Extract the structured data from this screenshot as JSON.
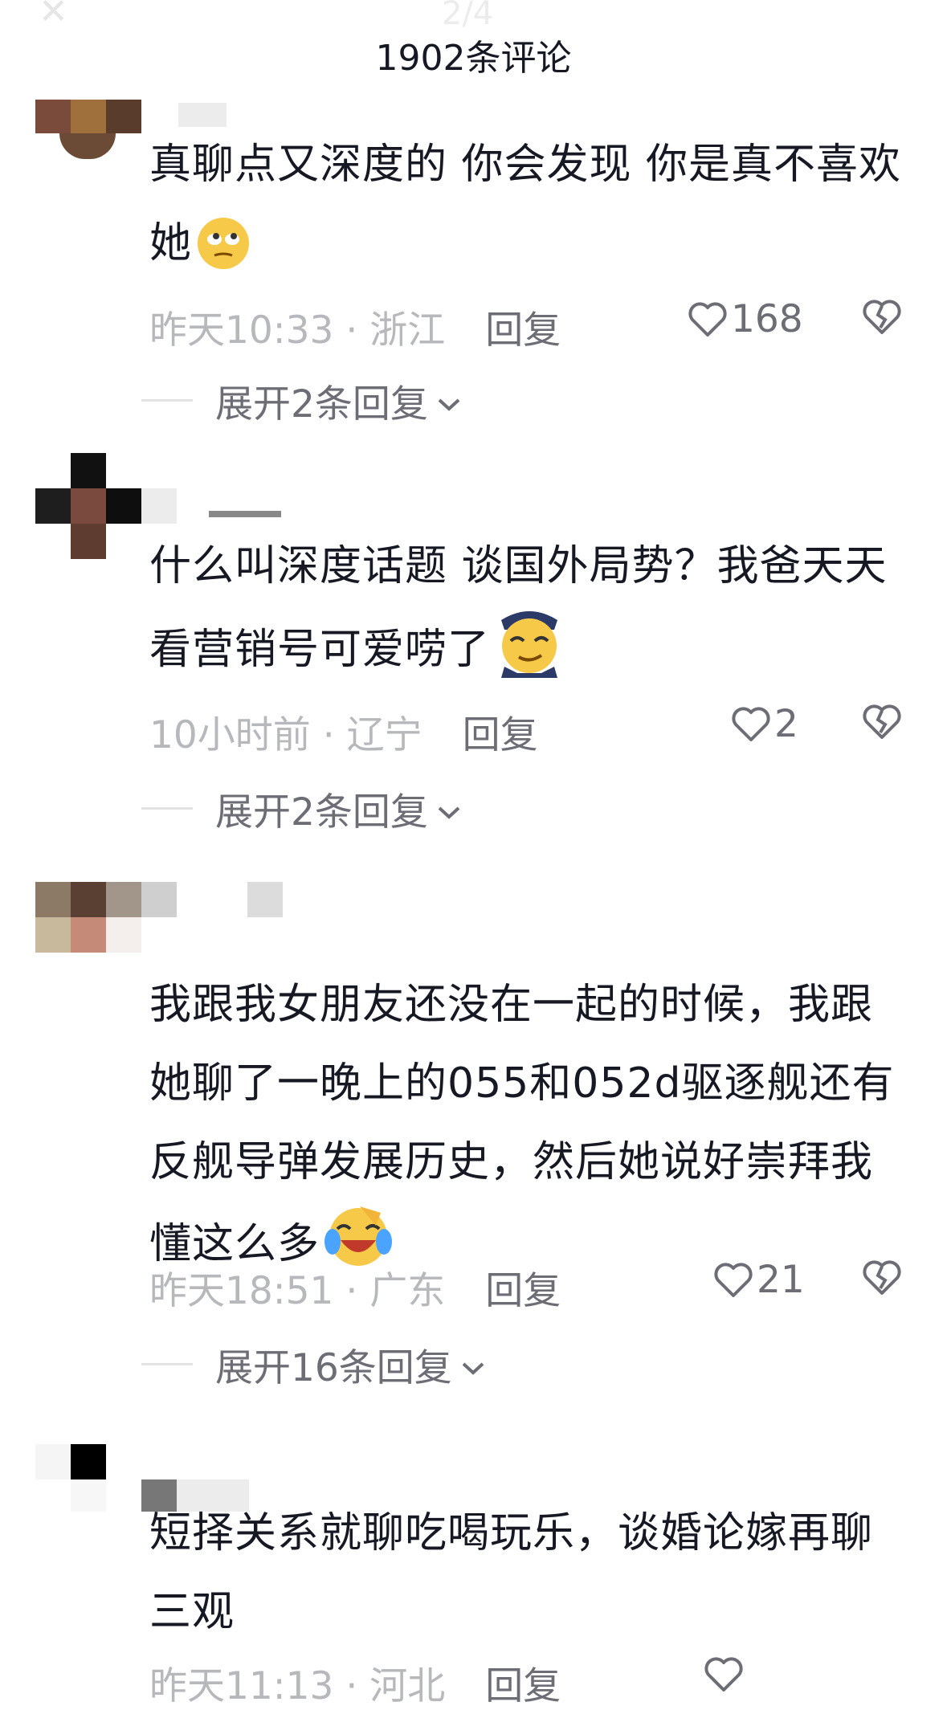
{
  "header": {
    "page_indicator": "2/4",
    "comment_count_title": "1902条评论"
  },
  "comments": [
    {
      "text": "真聊点又深度的 你会发现 你是真不喜欢她",
      "time": "昨天10:33",
      "location": "浙江",
      "reply_label": "回复",
      "likes": "168",
      "expand_label": "展开2条回复",
      "emoji": "eye-roll-emoji"
    },
    {
      "text": "什么叫深度话题 谈国外局势？我爸天天看营销号可爱唠了",
      "time": "10小时前",
      "location": "辽宁",
      "reply_label": "回复",
      "likes": "2",
      "expand_label": "展开2条回复",
      "emoji": "smirk-emoji"
    },
    {
      "text": "我跟我女朋友还没在一起的时候，我跟她聊了一晚上的055和052d驱逐舰还有反舰导弹发展历史，然后她说好崇拜我懂这么多",
      "time": "昨天18:51",
      "location": "广东",
      "reply_label": "回复",
      "likes": "21",
      "expand_label": "展开16条回复",
      "emoji": "laugh-cry-emoji"
    },
    {
      "text": "短择关系就聊吃喝玩乐，谈婚论嫁再聊三观",
      "time": "昨天11:13",
      "location": "河北",
      "reply_label": "回复",
      "likes": ""
    }
  ],
  "separator": " · ",
  "colors": {
    "text": "#161823",
    "meta": "#b7b8bc",
    "secondary": "#6d6e75",
    "emoji_yellow": "#f7c948"
  }
}
